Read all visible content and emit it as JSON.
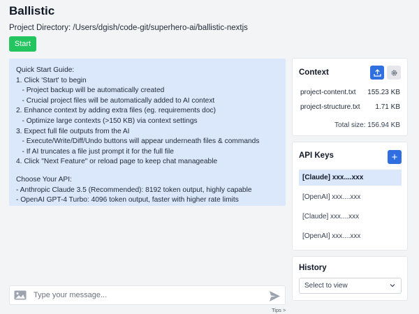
{
  "app": {
    "title": "Ballistic"
  },
  "project": {
    "label": "Project Directory: /Users/dgish/code-git/superhero-ai/ballistic-nextjs",
    "start_label": "Start"
  },
  "guide": {
    "lines": [
      "Quick Start Guide:",
      "1. Click 'Start' to begin",
      "   - Project backup will be automatically created",
      "   - Crucial project files will be automatically added to AI context",
      "2. Enhance context by adding extra files (eg. requirements doc)",
      "   - Optimize large contexts (>150 KB) via context settings",
      "3. Expect full file outputs from the AI",
      "   - Execute/Write/Diff/Undo buttons will appear underneath files & commands",
      "   - If AI truncates a file just prompt it for the full file",
      "4. Click \"Next Feature\" or reload page to keep chat manageable",
      "",
      "Choose Your API:",
      "- Anthropic Claude 3.5 (Recommended): 8192 token output, highly capable",
      "- OpenAI GPT-4 Turbo: 4096 token output, faster with higher rate limits"
    ]
  },
  "chat": {
    "placeholder": "Type your message...",
    "tips_label": "Tips >"
  },
  "context": {
    "title": "Context",
    "files": [
      {
        "name": "project-content.txt",
        "size": "155.23 KB"
      },
      {
        "name": "project-structure.txt",
        "size": "1.71 KB"
      }
    ],
    "total": "Total size: 156.94 KB"
  },
  "api_keys": {
    "title": "API Keys",
    "add_label": "+",
    "items": [
      {
        "label": "[Claude] xxx....xxx",
        "active": true
      },
      {
        "label": "[OpenAI] xxx....xxx",
        "active": false
      },
      {
        "label": "[Claude] xxx....xxx",
        "active": false
      },
      {
        "label": "[OpenAI] xxx....xxx",
        "active": false
      }
    ]
  },
  "history": {
    "title": "History",
    "select_value": "Select to view"
  },
  "colors": {
    "accent_blue": "#2f6fe0",
    "start_green": "#22c55e",
    "guide_bg": "#dbe7fb"
  }
}
